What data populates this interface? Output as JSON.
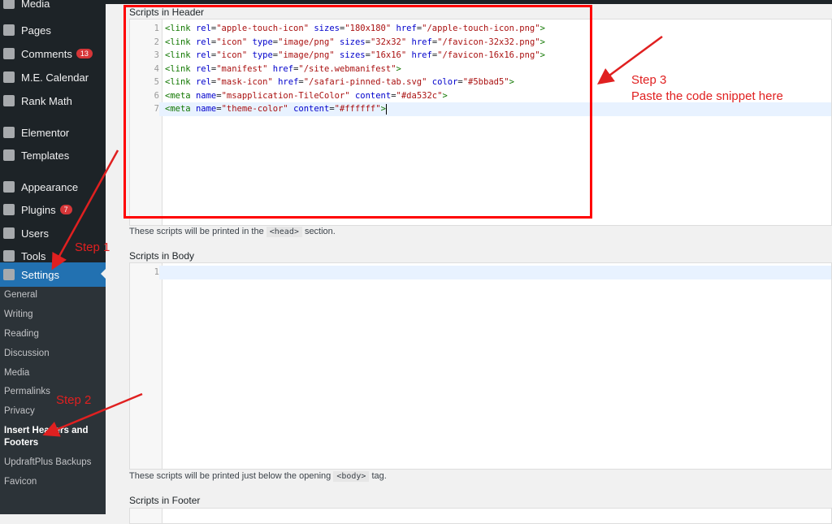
{
  "sidebar": {
    "items": [
      {
        "label": "Media",
        "icon": "media-icon"
      },
      {
        "label": "Pages",
        "icon": "pages-icon"
      },
      {
        "label": "Comments",
        "icon": "comments-icon",
        "badge": "13"
      },
      {
        "label": "M.E. Calendar",
        "icon": "calendar-icon"
      },
      {
        "label": "Rank Math",
        "icon": "rank-math-icon"
      },
      {
        "label": "Elementor",
        "icon": "elementor-icon"
      },
      {
        "label": "Templates",
        "icon": "folder-icon"
      },
      {
        "label": "Appearance",
        "icon": "brush-icon"
      },
      {
        "label": "Plugins",
        "icon": "plug-icon",
        "badge": "7"
      },
      {
        "label": "Users",
        "icon": "user-icon"
      },
      {
        "label": "Tools",
        "icon": "wrench-icon"
      },
      {
        "label": "Settings",
        "icon": "settings-icon",
        "active": true
      }
    ],
    "submenu": [
      "General",
      "Writing",
      "Reading",
      "Discussion",
      "Media",
      "Permalinks",
      "Privacy",
      "Insert Headers and Footers",
      "UpdraftPlus Backups",
      "Favicon"
    ]
  },
  "header_section": {
    "label": "Scripts in Header",
    "lines": [
      "<link rel=\"apple-touch-icon\" sizes=\"180x180\" href=\"/apple-touch-icon.png\">",
      "<link rel=\"icon\" type=\"image/png\" sizes=\"32x32\" href=\"/favicon-32x32.png\">",
      "<link rel=\"icon\" type=\"image/png\" sizes=\"16x16\" href=\"/favicon-16x16.png\">",
      "<link rel=\"manifest\" href=\"/site.webmanifest\">",
      "<link rel=\"mask-icon\" href=\"/safari-pinned-tab.svg\" color=\"#5bbad5\">",
      "<meta name=\"msapplication-TileColor\" content=\"#da532c\">",
      "<meta name=\"theme-color\" content=\"#ffffff\">"
    ],
    "desc_before": "These scripts will be printed in the",
    "desc_code": "<head>",
    "desc_after": "section."
  },
  "body_section": {
    "label": "Scripts in Body",
    "desc_before": "These scripts will be printed just below the opening",
    "desc_code": "<body>",
    "desc_after": "tag."
  },
  "footer_section": {
    "label": "Scripts in Footer"
  },
  "annotations": {
    "step1": "Step 1",
    "step2": "Step 2",
    "step3": "Step 3",
    "step3_note": "Paste the code snippet here",
    "color": "#e02020"
  }
}
